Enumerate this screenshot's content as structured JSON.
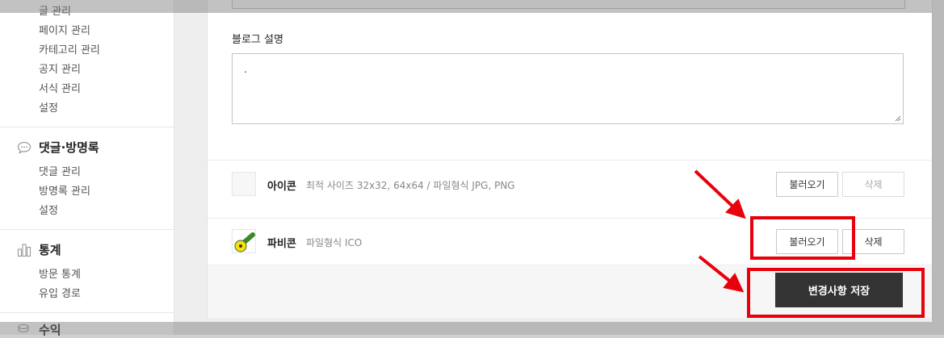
{
  "sidebar": {
    "post_items": [
      "글 관리",
      "페이지 관리",
      "카테고리 관리",
      "공지 관리",
      "서식 관리",
      "설정"
    ],
    "comments_section": {
      "title": "댓글·방명록",
      "icon": "speech-bubble-icon",
      "items": [
        "댓글 관리",
        "방명록 관리",
        "설정"
      ]
    },
    "stats_section": {
      "title": "통계",
      "icon": "bar-chart-icon",
      "items": [
        "방문 통계",
        "유입 경로"
      ]
    },
    "revenue_section": {
      "title": "수익",
      "icon": "coins-icon"
    }
  },
  "form": {
    "description_label": "블로그 설명",
    "description_value": "."
  },
  "icon_row": {
    "label": "아이콘",
    "hint": "최적 사이즈 32x32, 64x64 / 파일형식 JPG, PNG",
    "load_label": "불러오기",
    "delete_label": "삭제"
  },
  "favicon_row": {
    "label": "파비콘",
    "hint": "파일형식 ICO",
    "load_label": "불러오기",
    "delete_label": "삭제"
  },
  "save_label": "변경사항 저장",
  "colors": {
    "annotation": "#e8000b",
    "save_button": "#333333"
  }
}
